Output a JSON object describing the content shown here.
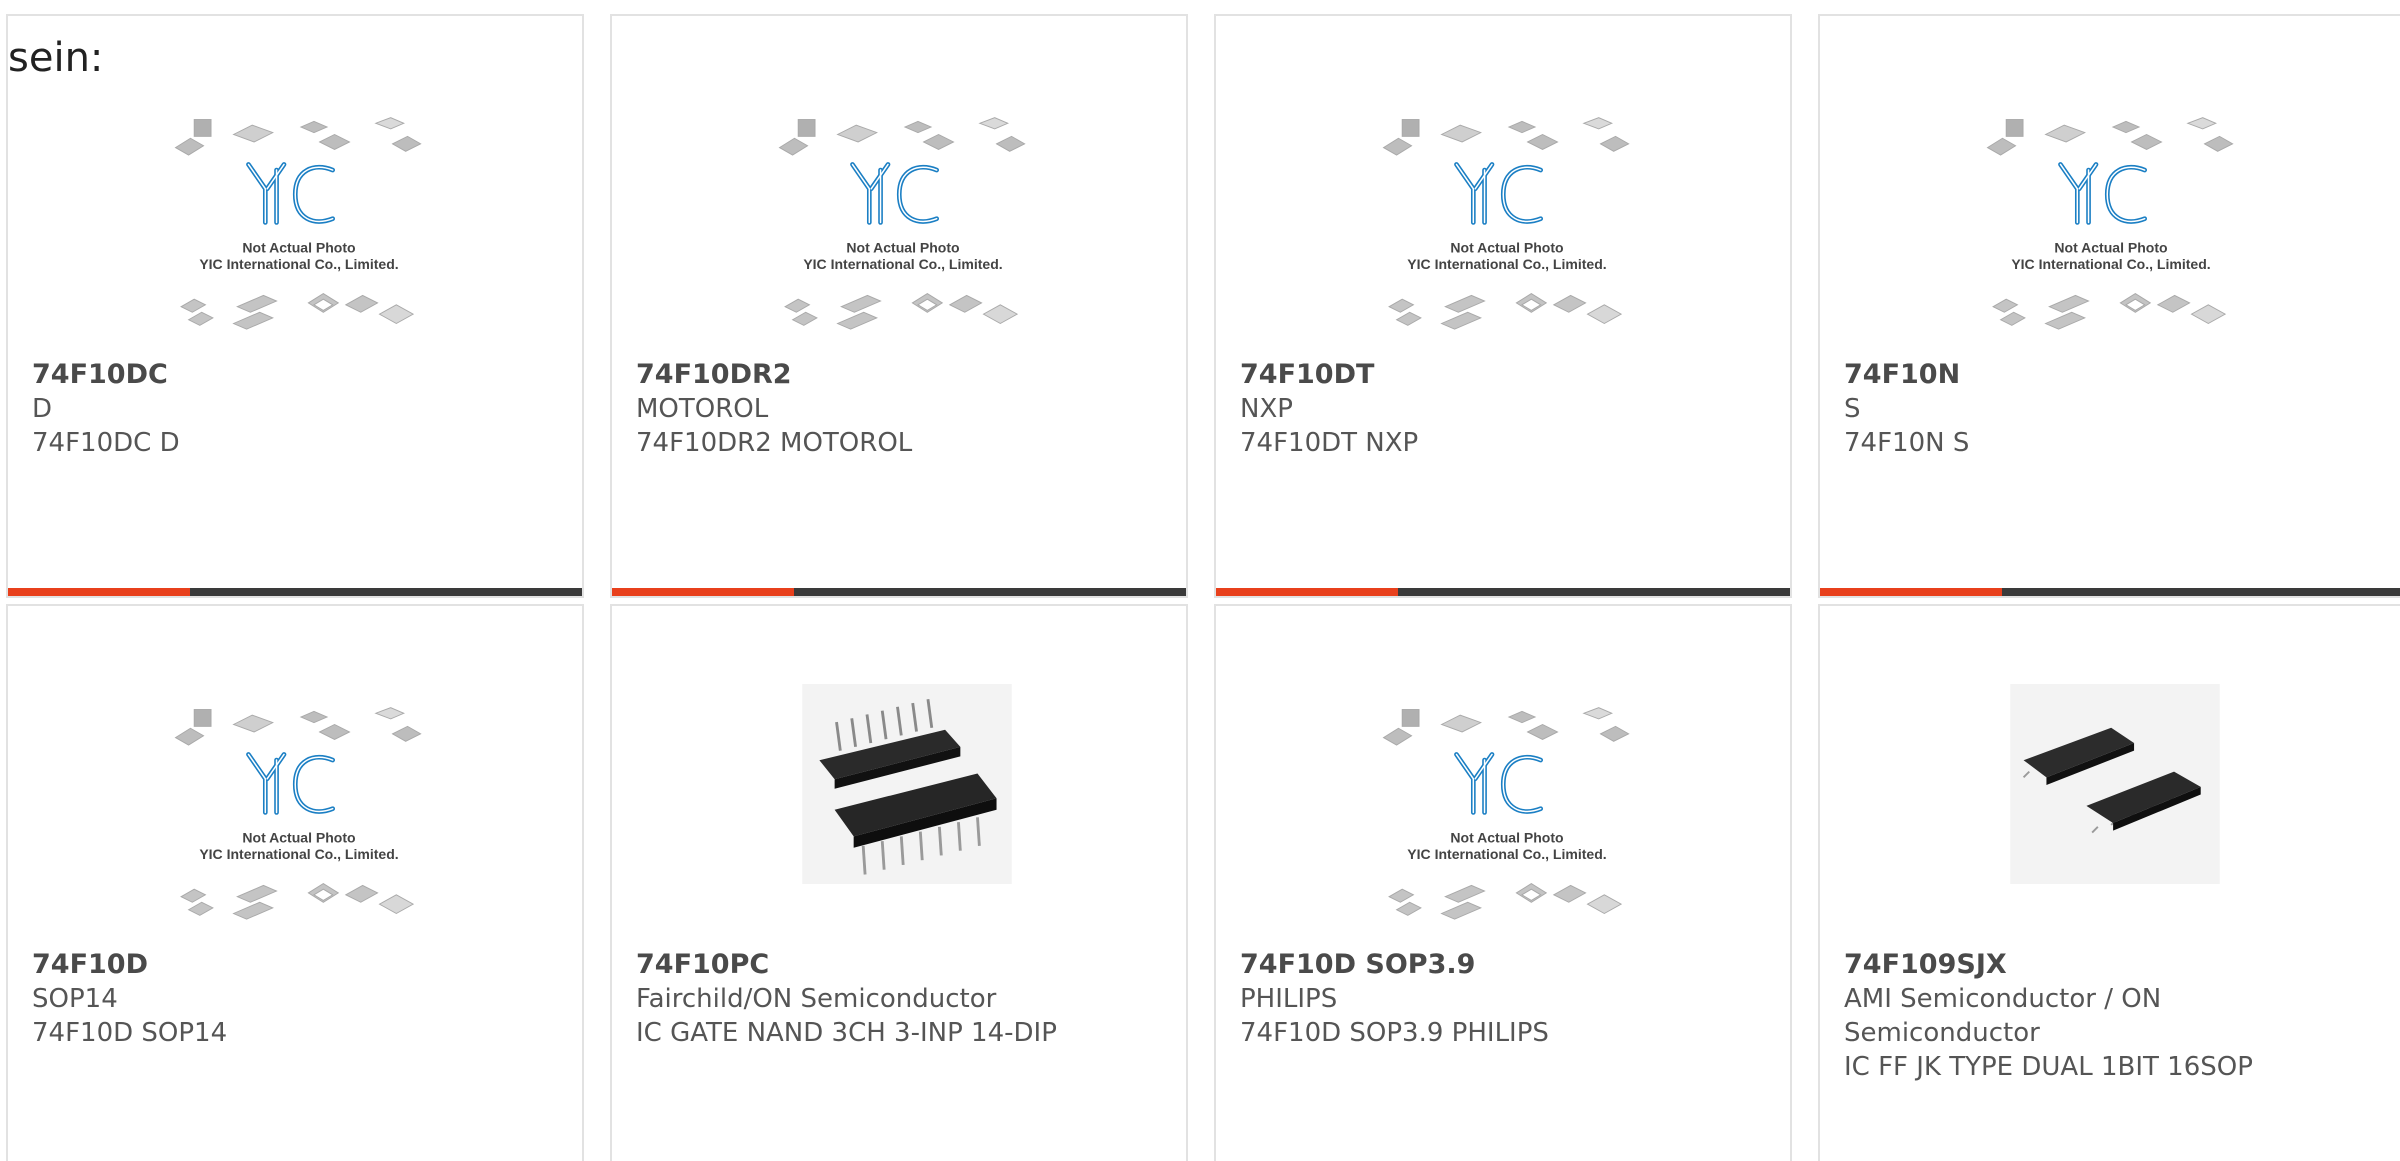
{
  "intro_text": "sein:",
  "placeholder": {
    "brand": "YIC",
    "line1": "Not Actual Photo",
    "line2": "YIC International Co., Limited."
  },
  "colors": {
    "accent": "#e8401c",
    "bar": "#3a3a3a",
    "brand_blue": "#1b7fc4"
  },
  "products": [
    {
      "name": "74F10DC",
      "maker": "D",
      "desc": "74F10DC D",
      "image": "yic-placeholder"
    },
    {
      "name": "74F10DR2",
      "maker": "MOTOROL",
      "desc": "74F10DR2 MOTOROL",
      "image": "yic-placeholder"
    },
    {
      "name": "74F10DT",
      "maker": "NXP",
      "desc": "74F10DT NXP",
      "image": "yic-placeholder"
    },
    {
      "name": "74F10N",
      "maker": "S",
      "desc": "74F10N S",
      "image": "yic-placeholder"
    },
    {
      "name": "74F10D",
      "maker": "SOP14",
      "desc": "74F10D SOP14",
      "image": "yic-placeholder"
    },
    {
      "name": "74F10PC",
      "maker": "Fairchild/ON Semiconductor",
      "desc": "IC GATE NAND 3CH 3-INP 14-DIP",
      "image": "dip-chip-photo"
    },
    {
      "name": "74F10D SOP3.9",
      "maker": "PHILIPS",
      "desc": "74F10D SOP3.9 PHILIPS",
      "image": "yic-placeholder"
    },
    {
      "name": "74F109SJX",
      "maker": "AMI Semiconductor / ON Semiconductor",
      "desc": "IC FF JK TYPE DUAL 1BIT 16SOP",
      "image": "soic-chip-photo"
    }
  ]
}
